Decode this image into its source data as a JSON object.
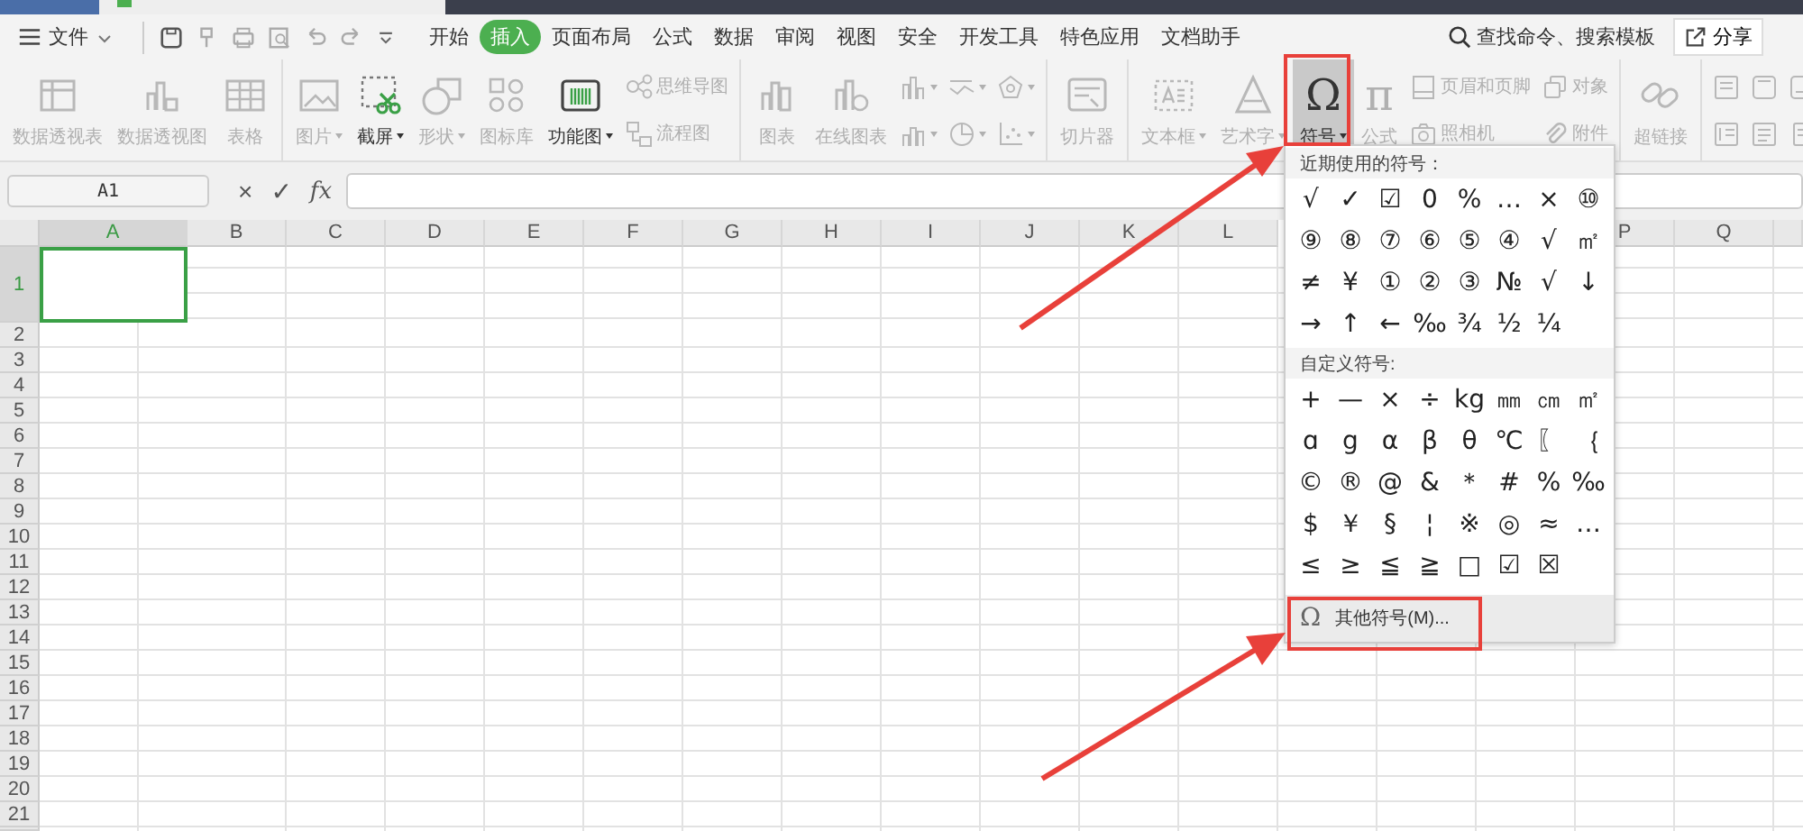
{
  "menu_bar": {
    "file_menu": "文件",
    "tabs": [
      {
        "label": "开始",
        "selected": false
      },
      {
        "label": "插入",
        "selected": true
      },
      {
        "label": "页面布局",
        "selected": false
      },
      {
        "label": "公式",
        "selected": false
      },
      {
        "label": "数据",
        "selected": false
      },
      {
        "label": "审阅",
        "selected": false
      },
      {
        "label": "视图",
        "selected": false
      },
      {
        "label": "安全",
        "selected": false
      },
      {
        "label": "开发工具",
        "selected": false
      },
      {
        "label": "特色应用",
        "selected": false
      },
      {
        "label": "文档助手",
        "selected": false
      }
    ],
    "search": "查找命令、搜索模板",
    "share_button": "分享"
  },
  "ribbon": {
    "groups": [
      {
        "items": [
          {
            "kind": "large",
            "label": "数据透视表",
            "disabled": true,
            "dropdown": false,
            "pressed": false
          },
          {
            "kind": "large",
            "label": "数据透视图",
            "disabled": true,
            "dropdown": false,
            "pressed": false
          },
          {
            "kind": "large",
            "label": "表格",
            "disabled": true,
            "dropdown": false,
            "pressed": false
          }
        ]
      },
      {
        "items": [
          {
            "kind": "large",
            "label": "图片",
            "disabled": true,
            "dropdown": true,
            "pressed": false
          },
          {
            "kind": "large",
            "label": "截屏",
            "disabled": false,
            "dropdown": true,
            "pressed": false
          },
          {
            "kind": "large",
            "label": "形状",
            "disabled": true,
            "dropdown": true,
            "pressed": false
          },
          {
            "kind": "large",
            "label": "图标库",
            "disabled": true,
            "dropdown": false,
            "pressed": false
          },
          {
            "kind": "large",
            "label": "功能图",
            "disabled": false,
            "dropdown": true,
            "pressed": false
          },
          {
            "kind": "stack",
            "items": [
              {
                "label": "思维导图",
                "disabled": true,
                "dropdown": false
              },
              {
                "label": "流程图",
                "disabled": true,
                "dropdown": false
              }
            ]
          }
        ]
      },
      {
        "items": [
          {
            "kind": "large",
            "label": "图表",
            "disabled": true,
            "dropdown": false,
            "pressed": false
          },
          {
            "kind": "large",
            "label": "在线图表",
            "disabled": true,
            "dropdown": false,
            "pressed": false
          },
          {
            "kind": "stack",
            "items": [
              {
                "disabled": true,
                "dropdown": true
              },
              {
                "disabled": true,
                "dropdown": true
              }
            ]
          },
          {
            "kind": "stack",
            "items": [
              {
                "disabled": true,
                "dropdown": true
              },
              {
                "disabled": true,
                "dropdown": true
              }
            ]
          },
          {
            "kind": "stack",
            "items": [
              {
                "disabled": true,
                "dropdown": true
              },
              {
                "disabled": true,
                "dropdown": true
              }
            ]
          }
        ]
      },
      {
        "items": [
          {
            "kind": "large",
            "label": "切片器",
            "disabled": true,
            "dropdown": false,
            "pressed": false
          }
        ]
      },
      {
        "items": [
          {
            "kind": "large",
            "label": "文本框",
            "disabled": true,
            "dropdown": true,
            "pressed": false
          },
          {
            "kind": "large",
            "label": "艺术字",
            "disabled": true,
            "dropdown": true,
            "pressed": false
          },
          {
            "kind": "large",
            "glyph": "Ω",
            "label": "符号",
            "disabled": false,
            "dropdown": true,
            "pressed": true
          },
          {
            "kind": "large",
            "glyph": "π",
            "label": "公式",
            "disabled": true,
            "dropdown": false,
            "pressed": false
          },
          {
            "kind": "stack",
            "items": [
              {
                "label": "页眉和页脚",
                "disabled": true,
                "dropdown": false
              },
              {
                "label": "照相机",
                "disabled": true,
                "dropdown": false
              }
            ]
          },
          {
            "kind": "stack",
            "items": [
              {
                "label": "对象",
                "disabled": true,
                "dropdown": false
              },
              {
                "label": "附件",
                "disabled": true,
                "dropdown": false
              }
            ]
          }
        ]
      },
      {
        "items": [
          {
            "kind": "large",
            "label": "超链接",
            "disabled": true,
            "dropdown": false,
            "pressed": false
          }
        ]
      },
      {
        "items": [
          {
            "kind": "stack",
            "items": [
              {
                "disabled": true,
                "dropdown": false
              },
              {
                "disabled": true,
                "dropdown": false
              }
            ]
          },
          {
            "kind": "stack",
            "items": [
              {
                "disabled": true,
                "dropdown": false
              },
              {
                "disabled": true,
                "dropdown": false
              }
            ]
          },
          {
            "kind": "stack",
            "items": [
              {
                "disabled": true,
                "dropdown": false
              },
              {
                "disabled": true,
                "dropdown": false
              }
            ]
          }
        ]
      }
    ]
  },
  "formula_bar": {
    "name_box": "A1",
    "cancel": "×",
    "confirm": "✓",
    "function": "fx"
  },
  "sheet": {
    "columns_left": [
      {
        "label": "A",
        "selected": true
      },
      {
        "label": "B",
        "selected": false
      },
      {
        "label": "C",
        "selected": false
      },
      {
        "label": "D",
        "selected": false
      },
      {
        "label": "E",
        "selected": false
      },
      {
        "label": "F",
        "selected": false
      },
      {
        "label": "G",
        "selected": false
      },
      {
        "label": "H",
        "selected": false
      },
      {
        "label": "I",
        "selected": false
      },
      {
        "label": "J",
        "selected": false
      },
      {
        "label": "K",
        "selected": false
      },
      {
        "label": "L",
        "selected": false
      }
    ],
    "columns_right": [
      {
        "label": "P",
        "selected": false
      },
      {
        "label": "Q",
        "selected": false
      }
    ],
    "rows": [
      {
        "label": "1",
        "selected": true
      },
      {
        "label": "2",
        "selected": false
      },
      {
        "label": "3",
        "selected": false
      },
      {
        "label": "4",
        "selected": false
      },
      {
        "label": "5",
        "selected": false
      },
      {
        "label": "6",
        "selected": false
      },
      {
        "label": "7",
        "selected": false
      },
      {
        "label": "8",
        "selected": false
      },
      {
        "label": "9",
        "selected": false
      },
      {
        "label": "10",
        "selected": false
      },
      {
        "label": "11",
        "selected": false
      },
      {
        "label": "12",
        "selected": false
      },
      {
        "label": "13",
        "selected": false
      },
      {
        "label": "14",
        "selected": false
      },
      {
        "label": "15",
        "selected": false
      },
      {
        "label": "16",
        "selected": false
      },
      {
        "label": "17",
        "selected": false
      },
      {
        "label": "18",
        "selected": false
      },
      {
        "label": "19",
        "selected": false
      },
      {
        "label": "20",
        "selected": false
      },
      {
        "label": "21",
        "selected": false
      }
    ]
  },
  "symbol_menu": {
    "recent_title": "近期使用的符号：",
    "recent": [
      "√",
      "✓",
      "☑",
      "0",
      "%",
      "…",
      "×",
      "⑩",
      "⑨",
      "⑧",
      "⑦",
      "⑥",
      "⑤",
      "④",
      "√",
      "㎡",
      "≠",
      "¥",
      "①",
      "②",
      "③",
      "№",
      "√",
      "↓",
      "→",
      "↑",
      "←",
      "‰",
      "¾",
      "½",
      "¼"
    ],
    "custom_title": "自定义符号:",
    "custom": [
      "+",
      "—",
      "×",
      "÷",
      "kg",
      "㎜",
      "㎝",
      "㎡",
      "ɑ",
      "g",
      "α",
      "β",
      "θ",
      "℃",
      "〖",
      "｛",
      "©",
      "®",
      "@",
      "&",
      "＊",
      "#",
      "%",
      "‰",
      "$",
      "￥",
      "§",
      "¦",
      "※",
      "◎",
      "≈",
      "…",
      "≤",
      "≥",
      "≦",
      "≧",
      "□",
      "☑",
      "☒"
    ],
    "more": {
      "glyph": "Ω",
      "label": "其他符号(M)..."
    }
  }
}
